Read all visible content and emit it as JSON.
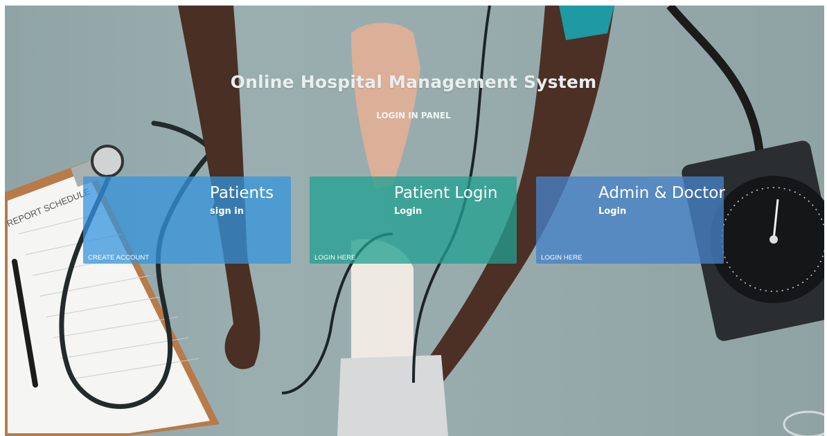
{
  "page": {
    "title": "Online Hospital Management System",
    "subtitle": "LOGIN IN PANEL"
  },
  "cards": [
    {
      "heading": "Patients",
      "sub": "sign in",
      "link": "CREATE ACCOUNT",
      "color": "#3494dc"
    },
    {
      "heading": "Patient Login",
      "sub": "Login",
      "link": "LOGIN HERE",
      "color": "#21a091"
    },
    {
      "heading": "Admin & Doctor",
      "sub": "Login",
      "link": "LOGIN HERE",
      "color": "#4682c8"
    }
  ],
  "background": {
    "description_icons": [
      "stethoscope",
      "clipboard",
      "blood-pressure-gauge",
      "pen",
      "arms"
    ],
    "clipboard_label": "REPORT SCHEDULE"
  }
}
